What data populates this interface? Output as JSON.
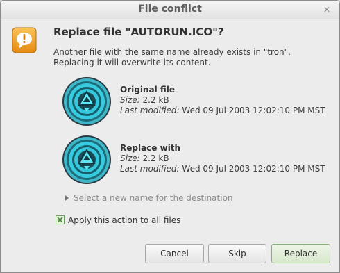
{
  "window": {
    "title": "File conflict",
    "close_icon": "close-icon"
  },
  "dialog": {
    "heading": "Replace file \"AUTORUN.ICO\"?",
    "description_line1": "Another file with the same name already exists in \"tron\".",
    "description_line2": "Replacing it will overwrite its content.",
    "warning_icon": "warning-speech-bubble-icon"
  },
  "original": {
    "title": "Original file",
    "size_label": "Size:",
    "size_value": "2.2 kB",
    "modified_label": "Last modified:",
    "modified_value": "Wed 09 Jul 2003 12:02:10 PM MST"
  },
  "replacement": {
    "title": "Replace with",
    "size_label": "Size:",
    "size_value": "2.2 kB",
    "modified_label": "Last modified:",
    "modified_value": "Wed 09 Jul 2003 12:02:10 PM MST"
  },
  "expander": {
    "label": "Select a new name for the destination"
  },
  "apply_all": {
    "label": "Apply this action to all files",
    "checked": true
  },
  "buttons": {
    "cancel": "Cancel",
    "skip": "Skip",
    "replace": "Replace"
  },
  "colors": {
    "accent_green": "#8cb07a",
    "warning_orange": "#f0a030",
    "icon_cyan": "#2fd3e6"
  }
}
